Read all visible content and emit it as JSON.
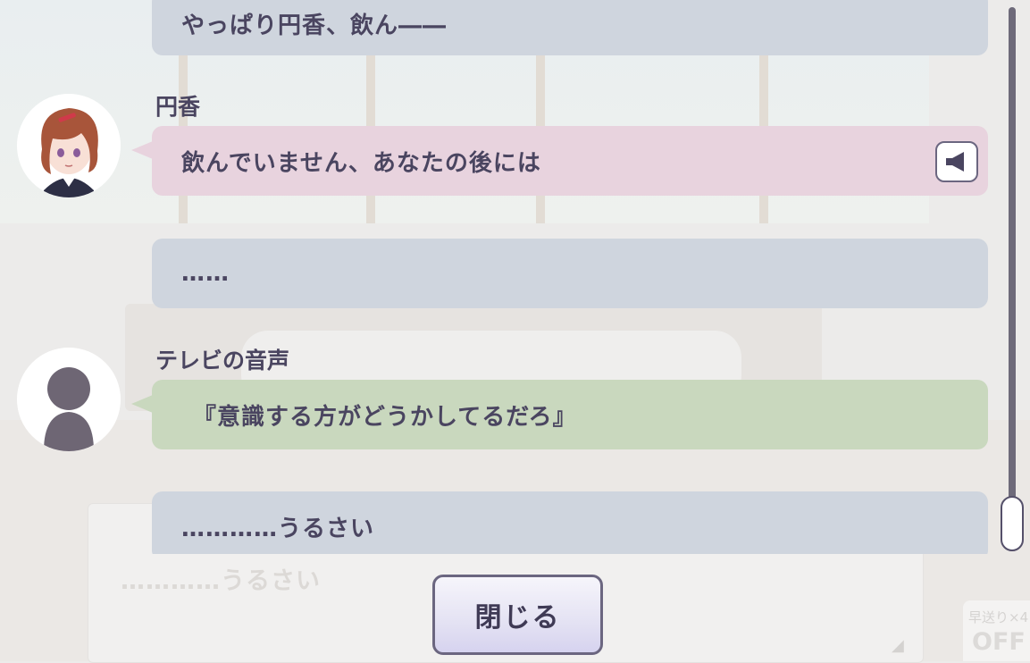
{
  "log": {
    "entries": [
      {
        "speaker": "",
        "text": "やっぱり円香、飲ん――",
        "style": "narration"
      },
      {
        "speaker": "円香",
        "text": "飲んでいません、あなたの後には",
        "style": "character"
      },
      {
        "speaker": "",
        "text": "……",
        "style": "narration"
      },
      {
        "speaker": "テレビの音声",
        "text": "『意識する方がどうかしてるだろ』",
        "style": "other"
      },
      {
        "speaker": "",
        "text": "…………うるさい",
        "style": "narration"
      }
    ]
  },
  "background": {
    "underlying_text": "…………うるさい",
    "auto_label": "早送り×4",
    "auto_value": "OFF"
  },
  "close_button": {
    "label": "閉じる"
  },
  "colors": {
    "narration_bubble": "#cfd5de",
    "character_bubble": "#e8d3de",
    "other_bubble": "#c9d8be",
    "text": "#4a4560"
  }
}
